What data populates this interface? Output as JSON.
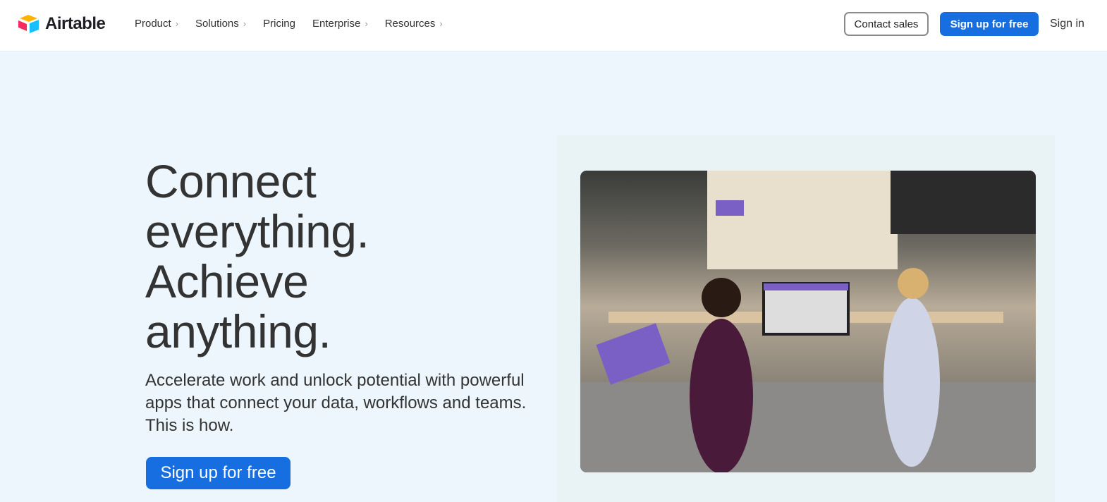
{
  "nav": {
    "brand": "Airtable",
    "menu": [
      {
        "label": "Product",
        "chevron": true
      },
      {
        "label": "Solutions",
        "chevron": true
      },
      {
        "label": "Pricing",
        "chevron": false
      },
      {
        "label": "Enterprise",
        "chevron": true
      },
      {
        "label": "Resources",
        "chevron": true
      }
    ],
    "contact_sales": "Contact sales",
    "sign_up": "Sign up for free",
    "sign_in": "Sign in"
  },
  "hero": {
    "title": "Connect everything. Achieve anything.",
    "subtitle": "Accelerate work and unlock potential with powerful apps that connect your data, workflows and teams. This is how.",
    "cta": "Sign up for free",
    "image": "office-photo"
  },
  "colors": {
    "accent": "#166ee1",
    "hero_bg": "#ecf6fc"
  }
}
